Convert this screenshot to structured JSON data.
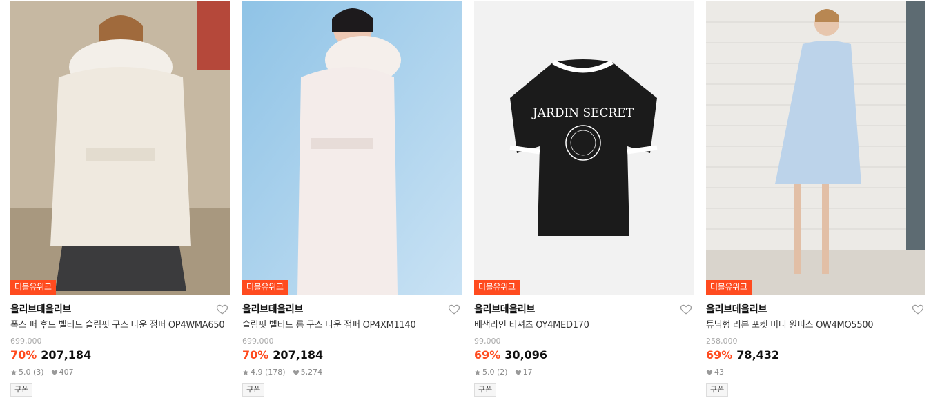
{
  "products": [
    {
      "badge": "더블유위크",
      "brand": "올리브데올리브",
      "name": "폭스 퍼 후드 벨티드 슬림핏 구스 다운 점퍼 OP4WMA650",
      "original_price": "699,000",
      "discount": "70%",
      "price": "207,184",
      "rating": "5.0 (3)",
      "likes": "407",
      "coupon": "쿠폰",
      "image": "white-fur-hooded-puffer-jacket"
    },
    {
      "badge": "더블유위크",
      "brand": "올리브데올리브",
      "name": "슬림핏 벨티드 롱 구스 다운 점퍼 OP4XM1140",
      "original_price": "699,000",
      "discount": "70%",
      "price": "207,184",
      "rating": "4.9 (178)",
      "likes": "5,274",
      "coupon": "쿠폰",
      "image": "long-white-puffer-coat"
    },
    {
      "badge": "더블유위크",
      "brand": "올리브데올리브",
      "name": "배색라인 티셔츠 OY4MED170",
      "original_price": "99,000",
      "discount": "69%",
      "price": "30,096",
      "rating": "5.0 (2)",
      "likes": "17",
      "coupon": "쿠폰",
      "image": "black-ringer-tshirt",
      "print_text": "JARDIN SECRET"
    },
    {
      "badge": "더블유위크",
      "brand": "올리브데올리브",
      "name": "튜닉형 리본 포켓 미니 원피스 OW4MO5500",
      "original_price": "258,000",
      "discount": "69%",
      "price": "78,432",
      "rating": "",
      "likes": "43",
      "coupon": "쿠폰",
      "image": "light-blue-mini-dress"
    }
  ],
  "colors": {
    "accent": "#ff4b1f",
    "muted": "#888888"
  }
}
